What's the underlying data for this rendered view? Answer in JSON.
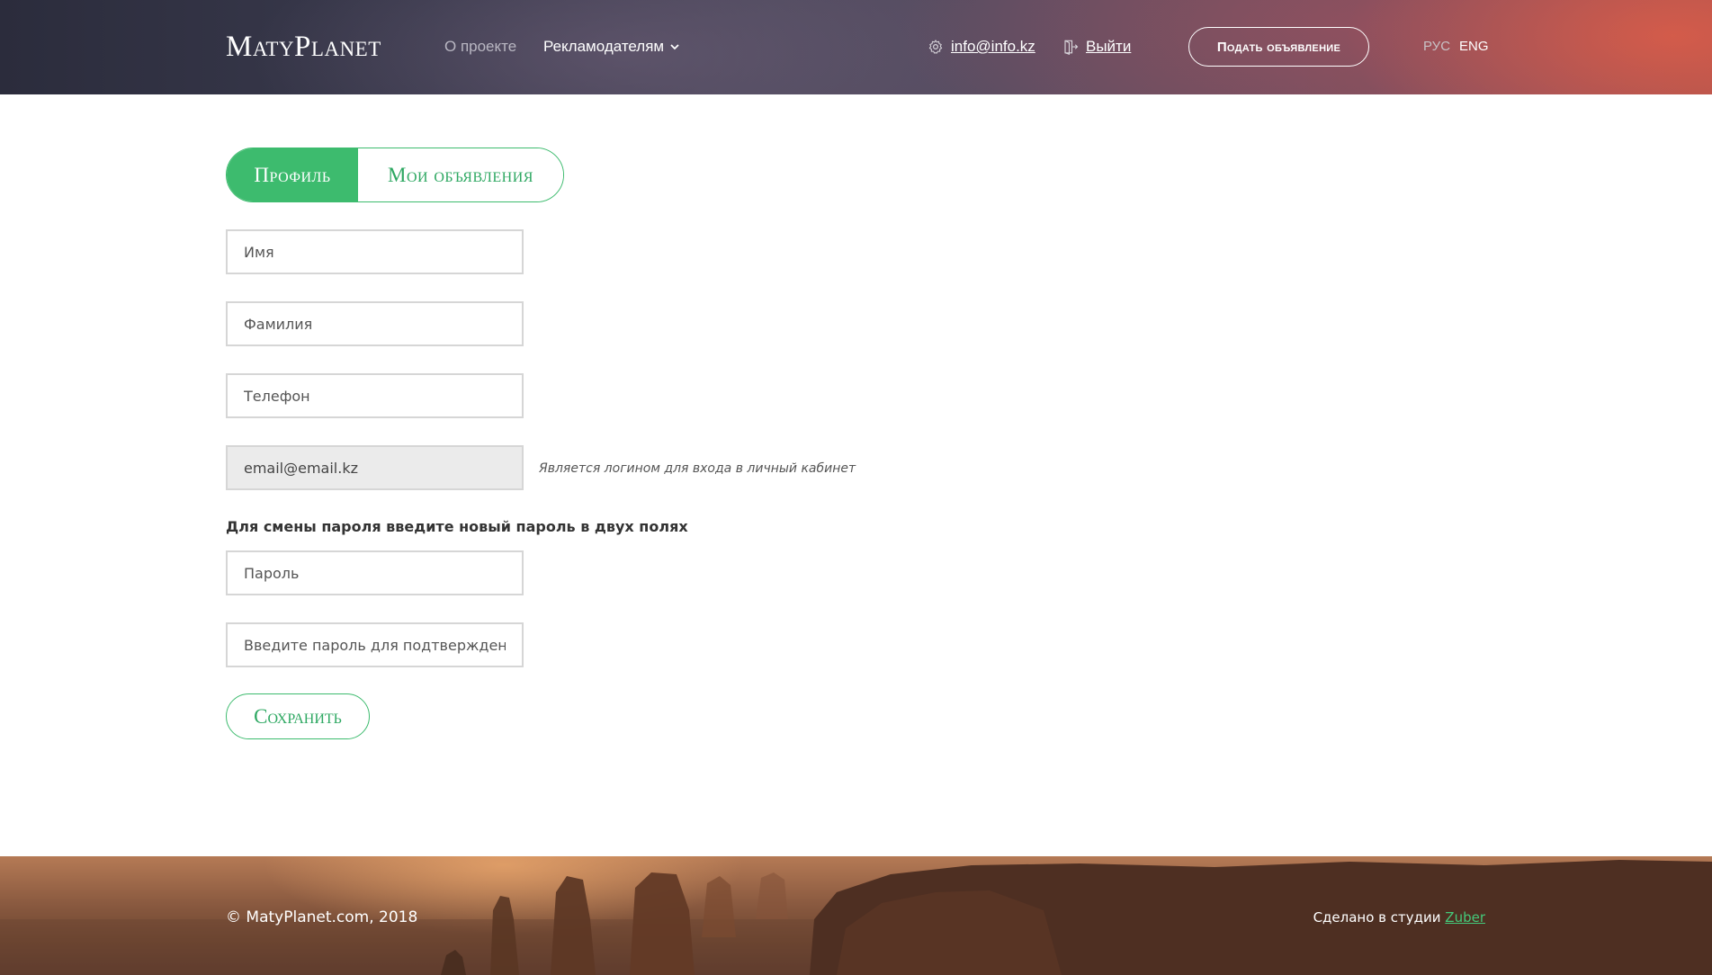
{
  "header": {
    "logo": "MatyPlanet",
    "nav": {
      "about": "О проекте",
      "advertisers": "Рекламодателям"
    },
    "email": "info@info.kz",
    "logout": "Выйти",
    "post_ad_button": "Подать объявление",
    "lang": {
      "ru": "РУС",
      "en": "ENG",
      "active": "ENG"
    }
  },
  "tabs": [
    {
      "label": "Профиль",
      "active": true
    },
    {
      "label": "Мои объявления",
      "active": false
    }
  ],
  "form": {
    "first_name": {
      "placeholder": "Имя",
      "value": ""
    },
    "last_name": {
      "placeholder": "Фамилия",
      "value": ""
    },
    "phone": {
      "placeholder": "Телефон",
      "value": ""
    },
    "email": {
      "value": "email@email.kz",
      "hint": "Является логином для входа в личный кабинет"
    },
    "password_section_label": "Для смены пароля введите новый пароль в двух полях",
    "password": {
      "placeholder": "Пароль"
    },
    "password_confirm": {
      "placeholder": "Введите пароль для подтверждения"
    },
    "save_button": "Сохранить"
  },
  "footer": {
    "copyright": "© MatyPlanet.com, 2018",
    "made_by_prefix": "Сделано в студии",
    "studio_name": "Zuber"
  },
  "colors": {
    "accent_green": "#3dbb6e",
    "link_green": "#44c97a"
  }
}
